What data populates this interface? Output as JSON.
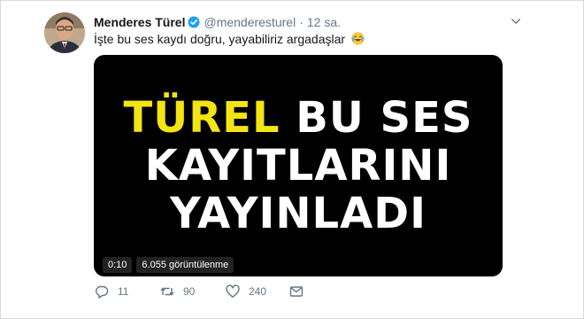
{
  "author": {
    "name": "Menderes Türel",
    "handle": "@menderesturel",
    "time": "12 sa."
  },
  "tweet": {
    "text": "İşte bu ses kaydı doğru, yayabiliriz argadaşlar",
    "emoji": "face-with-tears-of-joy-icon"
  },
  "media": {
    "headline_lines": [
      {
        "highlight": "TÜREL",
        "rest": " BU SES"
      },
      {
        "highlight": "",
        "rest": "KAYITLARINI"
      },
      {
        "highlight": "",
        "rest": "YAYINLADI"
      }
    ],
    "duration": "0:10",
    "views": "6.055 görüntülenme"
  },
  "actions": {
    "reply_count": "11",
    "retweet_count": "90",
    "like_count": "240"
  },
  "colors": {
    "highlight": "#f3e414",
    "verified": "#1da1f2",
    "muted": "#657786"
  }
}
